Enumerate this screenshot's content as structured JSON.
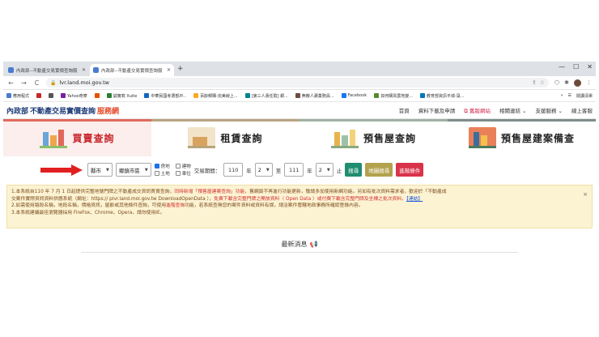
{
  "browser": {
    "tabs": [
      {
        "title": "內政部--不動產交易實價查詢服",
        "active": false
      },
      {
        "title": "內政部--不動產交易實價查詢服",
        "active": true
      }
    ],
    "new_tab": "+",
    "url": "lvr.land.moi.gov.tw",
    "back": "←",
    "forward": "→",
    "reload": "C"
  },
  "bookmarks": {
    "items": [
      "應用程式",
      "",
      "",
      "Yahoo奇摩",
      "",
      "誠實寫 Xuite",
      "中華民國考選部/P...",
      "百齡郵購-完美線上...",
      "[第三人責任險] 銀...",
      "無敵人壽業務員...",
      "Facebook",
      "如何購買農地變...",
      "教育部資訊平城-臭..."
    ],
    "reading_list": "閱讀清單"
  },
  "site": {
    "logo_mark": "內政部",
    "logo_name": "不動產交易實價查詢",
    "logo_suffix": "服務網",
    "nav": [
      "首頁",
      "資料下載及申請",
      "舊版網站",
      "相關連結",
      "支援服務",
      "線上客服"
    ]
  },
  "categories": [
    "買賣查詢",
    "租賃查詢",
    "預售屋查詢",
    "預售屋建案備查"
  ],
  "search": {
    "county": "縣市",
    "district": "鄉鎮市區",
    "checks": [
      {
        "label": "房地",
        "checked": true
      },
      {
        "label": "建物",
        "checked": false
      },
      {
        "label": "土地",
        "checked": false
      },
      {
        "label": "車位",
        "checked": false
      }
    ],
    "period_label": "交易期間：",
    "start_year": "110",
    "start_month": "2",
    "to_label": "至",
    "end_year": "111",
    "end_month": "2",
    "end_label": "止",
    "btn_search": "搜尋",
    "btn_map": "地圖搜尋",
    "btn_advanced": "進階條件"
  },
  "notice": {
    "l1a": "1.本系統自110 年 7 月 1 日起提供完整地號門牌之不動產成交資訊買賣查詢，",
    "l1b": "同時新增「預售屋建案查詢」功能，",
    "l1c": "舊網頁不再進行功能更新，敬請多加使用新網功能。另如有批次資料需求者，歡迎於「不動產成",
    "l2a": "交案件實際資訊資料供應系統（網址：https:// plvr.land.moi.gov.tw DownloadOpenData ），",
    "l2b": "免費下載含完整門牌之開放資料（ Open Data ）或付費下載含完整門牌及坐標之批次資料。",
    "l2c": "【連結】",
    "l3a": "2.如需使用路段名稱，地段名稱，價格資訊，屋齡或其他條件查詢，可使用",
    "l3b": "進階查詢",
    "l3c": "功能，若系統查無您的案件資料或資料有誤，請洽案件管轄地政事務所確認登錄內容。",
    "l4": "3.本系統建議最佳瀏覽器採用 FireFox、Chrome、Opera，請勿使用IE。",
    "close": "×"
  },
  "news": {
    "title": "最新消息"
  }
}
